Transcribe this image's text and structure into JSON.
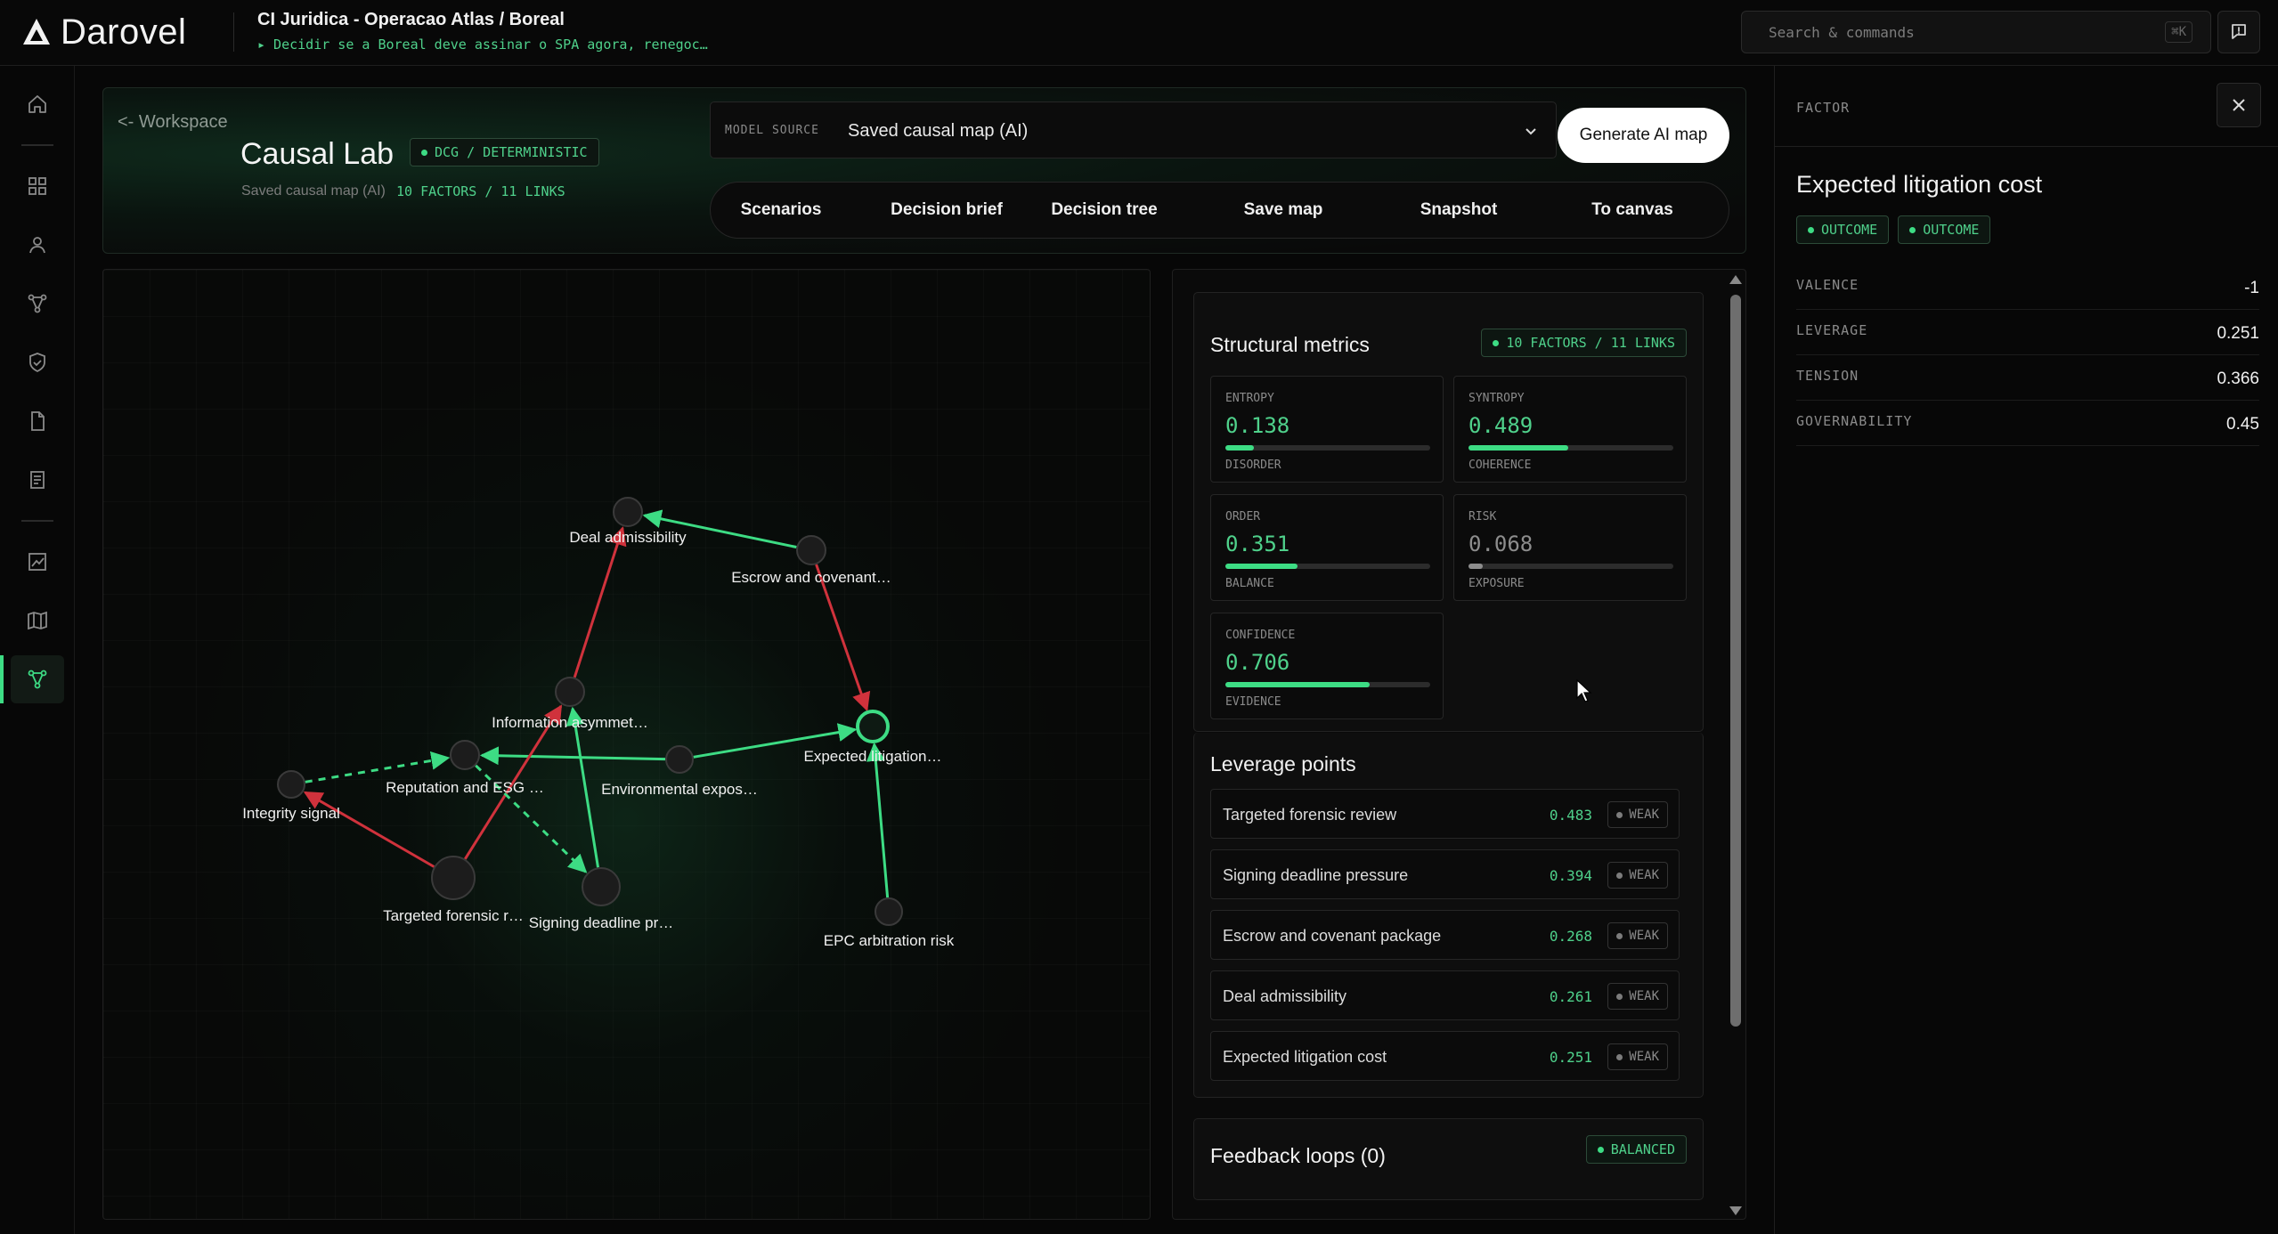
{
  "app": {
    "brand": "Darovel",
    "project_title": "CI Juridica - Operacao Atlas / Boreal",
    "project_subtitle": "▸ Decidir se a Boreal deve assinar o SPA agora, renegoc…",
    "search_placeholder": "Search & commands",
    "search_shortcut": "⌘K"
  },
  "sidebar": {
    "items": [
      {
        "name": "home-icon"
      },
      {
        "name": "grid-icon"
      },
      {
        "name": "user-icon"
      },
      {
        "name": "branch-icon"
      },
      {
        "name": "shield-icon"
      },
      {
        "name": "file-icon"
      },
      {
        "name": "document-icon"
      },
      {
        "name": "chart-icon"
      },
      {
        "name": "map-icon"
      },
      {
        "name": "causal-icon",
        "active": true
      }
    ]
  },
  "header": {
    "back_label": "<- Workspace",
    "title": "Causal Lab",
    "mode_badge": "DCG / DETERMINISTIC",
    "subtitle": "Saved causal map (AI)",
    "count": "10 FACTORS / 11 LINKS",
    "model_source_label": "MODEL SOURCE",
    "model_source_value": "Saved causal map (AI)",
    "generate_label": "Generate AI map",
    "tabs": [
      "Scenarios",
      "Decision brief",
      "Decision tree",
      "Save map",
      "Snapshot",
      "To canvas"
    ]
  },
  "graph": {
    "nodes": [
      {
        "id": "deal",
        "label": "Deal admissibility"
      },
      {
        "id": "escrow",
        "label": "Escrow and covenant…"
      },
      {
        "id": "info",
        "label": "Information asymmet…"
      },
      {
        "id": "expected",
        "label": "Expected litigation…",
        "selected": true
      },
      {
        "id": "reputation",
        "label": "Reputation and ESG …"
      },
      {
        "id": "environmental",
        "label": "Environmental expos…"
      },
      {
        "id": "integrity",
        "label": "Integrity signal"
      },
      {
        "id": "targeted",
        "label": "Targeted forensic r…"
      },
      {
        "id": "signing",
        "label": "Signing deadline pr…"
      },
      {
        "id": "epc",
        "label": "EPC arbitration risk"
      }
    ],
    "edges": [
      {
        "from": "escrow",
        "to": "deal",
        "polarity": "positive",
        "style": "solid"
      },
      {
        "from": "info",
        "to": "deal",
        "polarity": "negative",
        "style": "solid"
      },
      {
        "from": "escrow",
        "to": "expected",
        "polarity": "negative",
        "style": "solid"
      },
      {
        "from": "environmental",
        "to": "expected",
        "polarity": "positive",
        "style": "solid"
      },
      {
        "from": "environmental",
        "to": "reputation",
        "polarity": "positive",
        "style": "solid"
      },
      {
        "from": "epc",
        "to": "expected",
        "polarity": "positive",
        "style": "solid"
      },
      {
        "from": "targeted",
        "to": "info",
        "polarity": "negative",
        "style": "solid"
      },
      {
        "from": "signing",
        "to": "info",
        "polarity": "positive",
        "style": "solid"
      },
      {
        "from": "targeted",
        "to": "integrity",
        "polarity": "negative",
        "style": "solid"
      },
      {
        "from": "integrity",
        "to": "reputation",
        "polarity": "positive",
        "style": "dashed"
      },
      {
        "from": "reputation",
        "to": "signing",
        "polarity": "positive",
        "style": "dashed"
      }
    ]
  },
  "metrics": {
    "title": "Structural metrics",
    "badge": "10 FACTORS / 11 LINKS",
    "boxes": [
      {
        "label": "ENTROPY",
        "value": "0.138",
        "fill": 0.138,
        "sub": "DISORDER",
        "dim": false
      },
      {
        "label": "SYNTROPY",
        "value": "0.489",
        "fill": 0.489,
        "sub": "COHERENCE",
        "dim": false
      },
      {
        "label": "ORDER",
        "value": "0.351",
        "fill": 0.351,
        "sub": "BALANCE",
        "dim": false
      },
      {
        "label": "RISK",
        "value": "0.068",
        "fill": 0.068,
        "sub": "EXPOSURE",
        "dim": true
      },
      {
        "label": "CONFIDENCE",
        "value": "0.706",
        "fill": 0.706,
        "sub": "EVIDENCE",
        "dim": false
      }
    ]
  },
  "leverage": {
    "title": "Leverage points",
    "rows": [
      {
        "name": "Targeted forensic review",
        "value": "0.483",
        "badge": "WEAK"
      },
      {
        "name": "Signing deadline pressure",
        "value": "0.394",
        "badge": "WEAK"
      },
      {
        "name": "Escrow and covenant package",
        "value": "0.268",
        "badge": "WEAK"
      },
      {
        "name": "Deal admissibility",
        "value": "0.261",
        "badge": "WEAK"
      },
      {
        "name": "Expected litigation cost",
        "value": "0.251",
        "badge": "WEAK"
      }
    ]
  },
  "feedback": {
    "title": "Feedback loops (0)",
    "badge": "BALANCED"
  },
  "factor": {
    "header": "FACTOR",
    "title": "Expected litigation cost",
    "tags": [
      "OUTCOME",
      "OUTCOME"
    ],
    "rows": [
      {
        "key": "VALENCE",
        "value": "-1"
      },
      {
        "key": "LEVERAGE",
        "value": "0.251"
      },
      {
        "key": "TENSION",
        "value": "0.366"
      },
      {
        "key": "GOVERNABILITY",
        "value": "0.45"
      }
    ]
  },
  "colors": {
    "accent": "#3ddc84",
    "positive_edge": "#3ddc84",
    "negative_edge": "#d0323c",
    "background": "#070707"
  }
}
